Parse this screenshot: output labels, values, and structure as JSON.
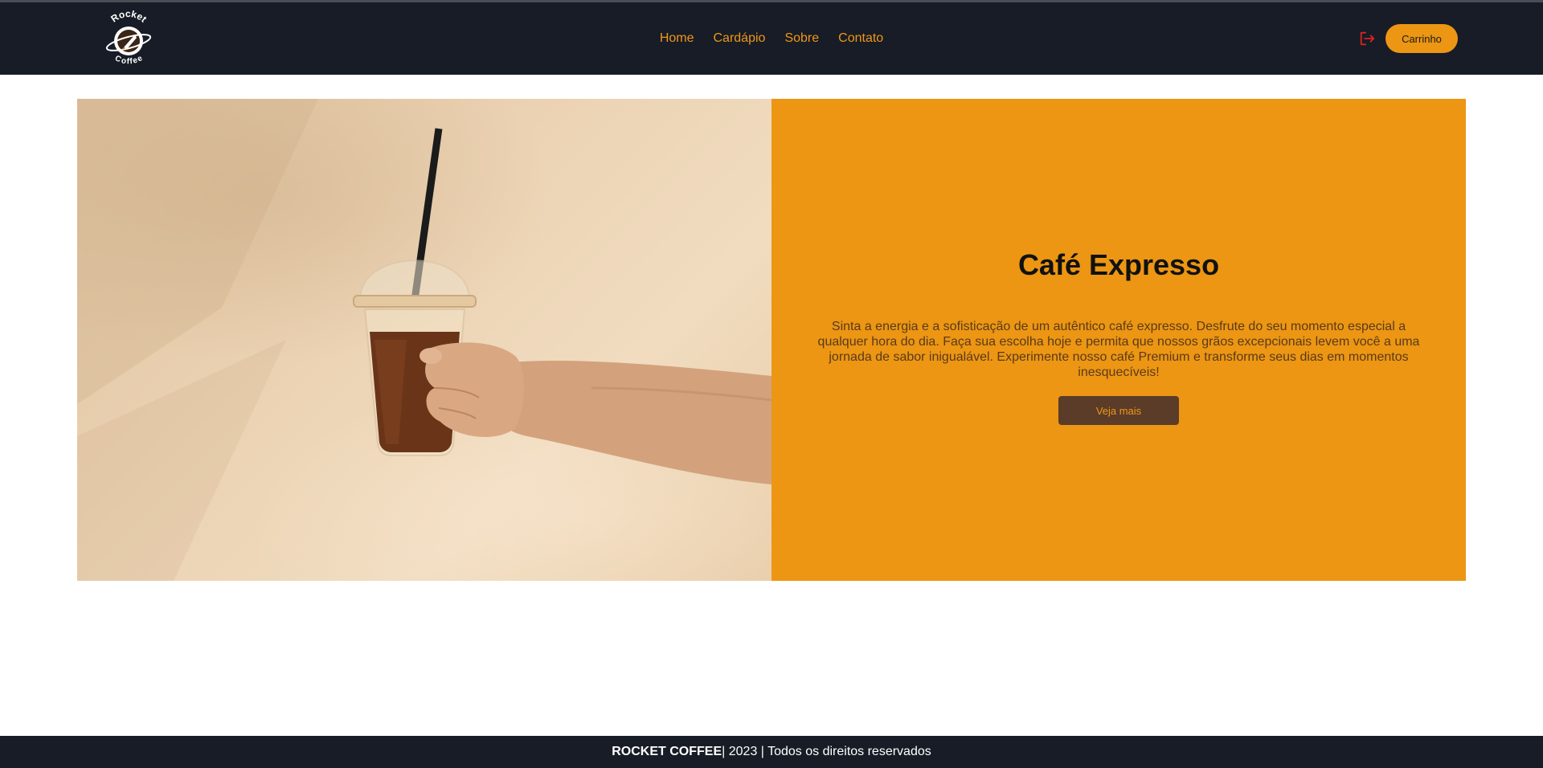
{
  "header": {
    "logo": {
      "line1": "Rocket",
      "line2": "Coffee"
    },
    "nav": [
      {
        "label": "Home"
      },
      {
        "label": "Cardápio"
      },
      {
        "label": "Sobre"
      },
      {
        "label": "Contato"
      }
    ],
    "logout_icon": "logout-icon",
    "cart_label": "Carrinho"
  },
  "hero": {
    "image_alt": "hand-holding-iced-coffee-image",
    "title": "Café Expresso",
    "description": "Sinta a energia e a sofisticação de um autêntico café expresso. Desfrute do seu momento especial a qualquer hora do dia. Faça sua escolha hoje e permita que nossos grãos excepcionais levem você a uma jornada de sabor inigualável. Experimente nosso café Premium e transforme seus dias em momentos inesquecíveis!",
    "button_label": "Veja mais"
  },
  "footer": {
    "brand": "ROCKET COFFEE",
    "rest": " | 2023 | Todos os direitos reservados"
  },
  "colors": {
    "header_bg": "#171c26",
    "accent": "#ec9613",
    "button_dark": "#5a3c28",
    "logout_icon": "#d9231f"
  }
}
